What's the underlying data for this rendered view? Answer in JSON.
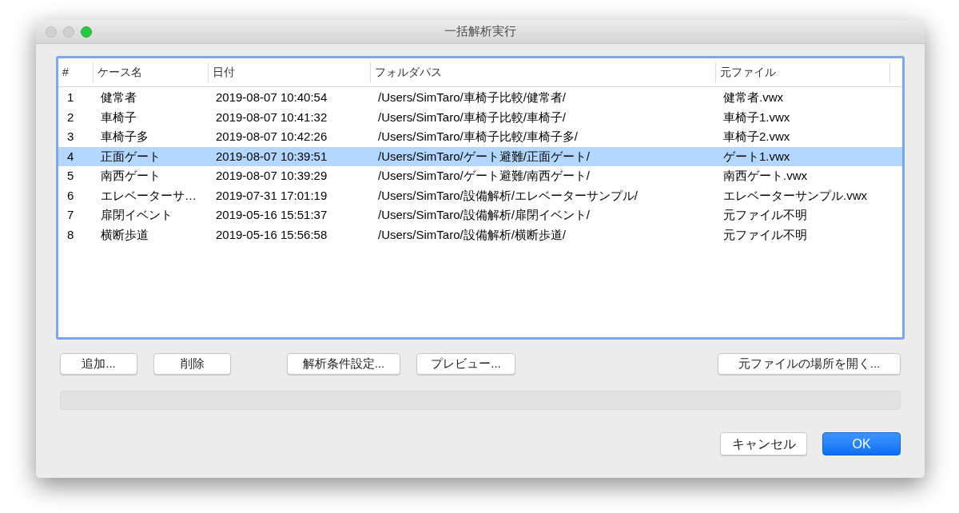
{
  "window": {
    "title": "一括解析実行"
  },
  "table": {
    "columns": [
      "#",
      "ケース名",
      "日付",
      "フォルダパス",
      "元ファイル"
    ],
    "rows": [
      {
        "cells": [
          "1",
          "健常者",
          "2019-08-07 10:40:54",
          "/Users/SimTaro/車椅子比較/健常者/",
          "健常者.vwx"
        ],
        "selected": false
      },
      {
        "cells": [
          "2",
          "車椅子",
          "2019-08-07 10:41:32",
          "/Users/SimTaro/車椅子比較/車椅子/",
          "車椅子1.vwx"
        ],
        "selected": false
      },
      {
        "cells": [
          "3",
          "車椅子多",
          "2019-08-07 10:42:26",
          "/Users/SimTaro/車椅子比較/車椅子多/",
          "車椅子2.vwx"
        ],
        "selected": false
      },
      {
        "cells": [
          "4",
          "正面ゲート",
          "2019-08-07 10:39:51",
          "/Users/SimTaro/ゲート避難/正面ゲート/",
          "ゲート1.vwx"
        ],
        "selected": true
      },
      {
        "cells": [
          "5",
          "南西ゲート",
          "2019-08-07 10:39:29",
          "/Users/SimTaro/ゲート避難/南西ゲート/",
          "南西ゲート.vwx"
        ],
        "selected": false
      },
      {
        "cells": [
          "6",
          "エレベーターサ…",
          "2019-07-31 17:01:19",
          "/Users/SimTaro/設備解析/エレベーターサンプル/",
          "エレベーターサンプル.vwx"
        ],
        "selected": false
      },
      {
        "cells": [
          "7",
          "扉閉イベント",
          "2019-05-16 15:51:37",
          "/Users/SimTaro/設備解析/扉閉イベント/",
          "元ファイル不明"
        ],
        "selected": false
      },
      {
        "cells": [
          "8",
          "横断歩道",
          "2019-05-16 15:56:58",
          "/Users/SimTaro/設備解析/横断歩道/",
          "元ファイル不明"
        ],
        "selected": false
      }
    ]
  },
  "left_buttons": [
    "追加...",
    "削除"
  ],
  "middle_buttons": [
    "解析条件設定...",
    "プレビュー..."
  ],
  "right_button": "元ファイルの場所を開く...",
  "progress": {
    "level": 0
  },
  "footer_buttons": [
    {
      "label": "キャンセル",
      "kind": "normal"
    },
    {
      "label": "OK",
      "kind": "default"
    }
  ]
}
